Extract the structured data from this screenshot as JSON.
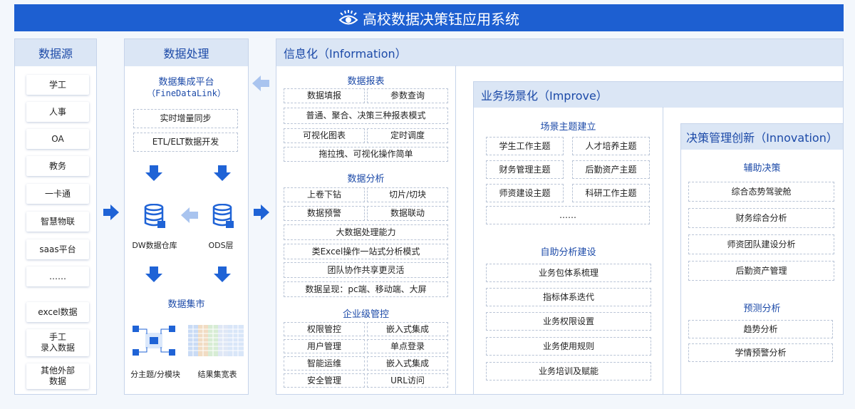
{
  "title": "高校数据决策钰应用系统",
  "sources": {
    "header": "数据源",
    "items": [
      "学工",
      "人事",
      "OA",
      "教务",
      "一卡通",
      "智慧物联",
      "saas平台",
      "……",
      "excel数据",
      "手工\n录入数据",
      "其他外部\n数据"
    ]
  },
  "processing": {
    "header": "数据处理",
    "platform_title": "数据集成平台",
    "platform_sub": "（FineDataLink）",
    "items": [
      "实时增量同步",
      "ETL/ELT数据开发"
    ],
    "dw_label": "DW数据仓库",
    "ods_label": "ODS层",
    "mart_title": "数据集市",
    "mart_left": "分主题/分模块",
    "mart_right": "结果集宽表"
  },
  "information": {
    "header": "信息化（Information）",
    "report_title": "数据报表",
    "report_items": [
      "数据填报",
      "参数查询",
      "普通、聚合、决策三种报表模式",
      "可视化图表",
      "定时调度",
      "拖拉拽、可视化操作简单"
    ],
    "analysis_title": "数据分析",
    "analysis_items": [
      "上卷下钻",
      "切片/切块",
      "数据预警",
      "数据联动",
      "大数据处理能力",
      "类Excel操作一站式分析模式",
      "团队协作共享更灵活",
      "数据呈现：pc端、移动端、大屏"
    ],
    "enterprise_title": "企业级管控",
    "enterprise_items": [
      "权限管控",
      "嵌入式集成",
      "用户管理",
      "单点登录",
      "智能运维",
      "嵌入式集成",
      "安全管理",
      "URL访问"
    ]
  },
  "improve": {
    "header": "业务场景化（Improve）",
    "scene_title": "场景主题建立",
    "scene_items": [
      "学生工作主题",
      "人才培养主题",
      "财务管理主题",
      "后勤资产主题",
      "师资建设主题",
      "科研工作主题",
      "……"
    ],
    "self_title": "自助分析建设",
    "self_items": [
      "业务包体系梳理",
      "指标体系迭代",
      "业务权限设置",
      "业务使用规则",
      "业务培训及赋能"
    ]
  },
  "innovation": {
    "header": "决策管理创新（Innovation）",
    "assist_title": "辅助决策",
    "assist_items": [
      "综合态势驾驶舱",
      "财务综合分析",
      "师资团队建设分析",
      "后勤资产管理"
    ],
    "predict_title": "预测分析",
    "predict_items": [
      "趋势分析",
      "学情预警分析"
    ]
  },
  "colors": {
    "banner": "#1d5fd1",
    "accent": "#1c4aa8",
    "arrow": "#1f63d6",
    "arrow_light": "#a9c4ef"
  }
}
